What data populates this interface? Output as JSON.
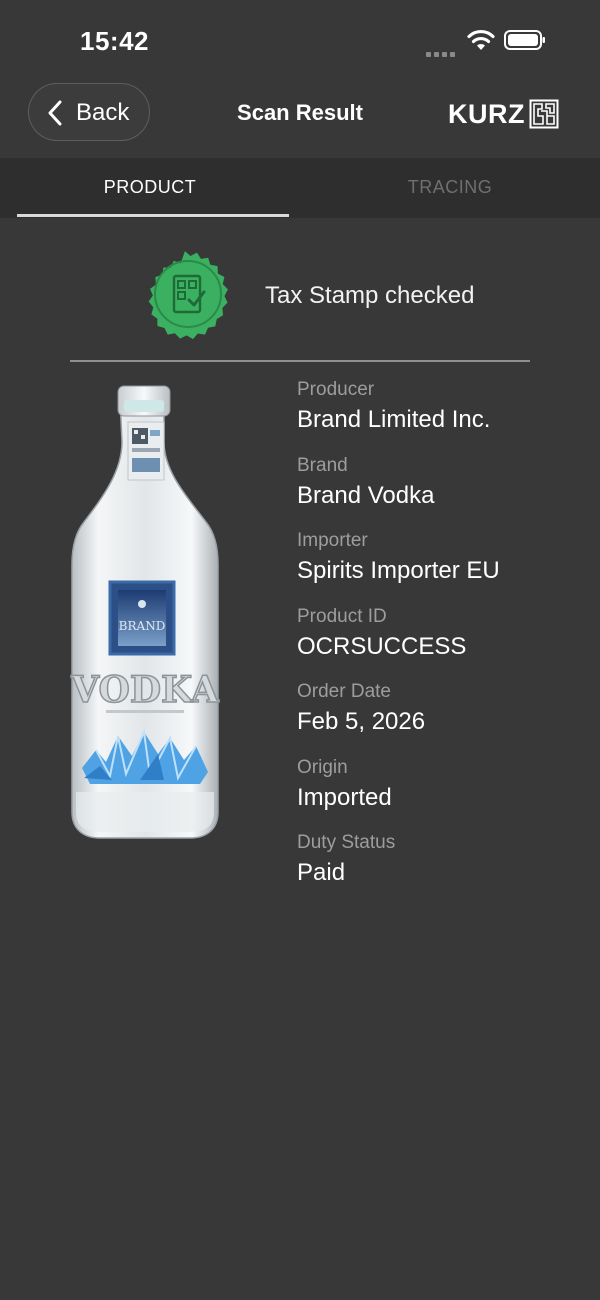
{
  "status_bar": {
    "time": "15:42",
    "icons": [
      "signal-icon",
      "wifi-icon",
      "battery-icon"
    ]
  },
  "nav": {
    "back_label": "Back",
    "title": "Scan Result",
    "brand": "KURZ"
  },
  "tabs": [
    {
      "label": "PRODUCT",
      "active": true
    },
    {
      "label": "TRACING",
      "active": false
    }
  ],
  "verification": {
    "text": "Tax Stamp checked",
    "icon": "tax-stamp-verified-icon",
    "color": "#3bb060"
  },
  "product": {
    "image": "vodka-bottle",
    "label_text": "VODKA",
    "fields": [
      {
        "label": "Producer",
        "value": "Brand Limited Inc."
      },
      {
        "label": "Brand",
        "value": "Brand Vodka"
      },
      {
        "label": "Importer",
        "value": "Spirits Importer EU"
      },
      {
        "label": "Product ID",
        "value": "OCRSUCCESS"
      },
      {
        "label": "Order Date",
        "value": "Feb 5, 2026"
      },
      {
        "label": "Origin",
        "value": "Imported"
      },
      {
        "label": "Duty Status",
        "value": "Paid"
      }
    ]
  },
  "colors": {
    "background": "#383838",
    "tab_bar": "#2e2e2e",
    "label_gray": "#9d9d9d",
    "accent_green": "#3bb060"
  }
}
